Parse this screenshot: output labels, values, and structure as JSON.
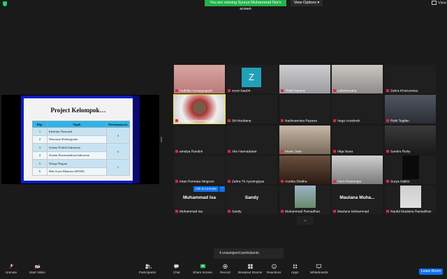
{
  "top": {
    "share_banner": "You are viewing Syurya Muhammad Nur's screen",
    "view_options": "View Options ▾",
    "view": "View"
  },
  "slide": {
    "title": "Project Kelompok…",
    "headers": [
      "Klp.",
      "Topik",
      "Pertemuan ke"
    ],
    "rows": [
      {
        "no": "1",
        "topic": "Identitas Nasional"
      },
      {
        "no": "2",
        "topic": "Wawasan Kebangsaan"
      },
      {
        "no": "3",
        "topic": "Sistem Politik Indonesia"
      },
      {
        "no": "4",
        "topic": "Sistem Pemerintahan Indonesia"
      },
      {
        "no": "5",
        "topic": "Warga Negara"
      },
      {
        "no": "6",
        "topic": "Hak Asasi Manusia (HAM)"
      }
    ],
    "meetings": [
      "3",
      "5",
      "7"
    ]
  },
  "gallery": {
    "tiles": [
      {
        "name": "Fadhilla Versayyaputri"
      },
      {
        "name": "zoom baa04",
        "initial": "Z"
      },
      {
        "name": "Thifal Namira"
      },
      {
        "name": "zalfahamaha"
      },
      {
        "name": "Zahra Khoirunnisa"
      },
      {
        "name": "Syurya Muhammad Nur"
      },
      {
        "name": "Siti Nurdiana"
      },
      {
        "name": "Nadimannisa Rayana"
      },
      {
        "name": "Vega Azzahrah"
      },
      {
        "name": "Rizki Tegilan"
      },
      {
        "name": "amelya Randini"
      },
      {
        "name": "Alia Hannadatari"
      },
      {
        "name": "Imam Joan"
      },
      {
        "name": "rifqa lizara"
      },
      {
        "name": "Sandro Rizky"
      },
      {
        "name": "Intan Permata Ningrum"
      },
      {
        "name": "Zahra Tri Ayuningtyas"
      },
      {
        "name": "Aurelia Shafira"
      },
      {
        "name": "Hani Khairuniya"
      },
      {
        "name": "Surya Hakim"
      },
      {
        "name": "Muhammad Isa",
        "big": "Muhammad Isa"
      },
      {
        "name": "Sandy",
        "big": "Sandy"
      },
      {
        "name": "Muhammad Ramadhan"
      },
      {
        "name": "Maulana Muhammad",
        "big": "Maulana Muha..."
      },
      {
        "name": "Naufal Maulana Ramadhan"
      }
    ],
    "ask_unmute": "Ask to Unmute",
    "ask_more": "···"
  },
  "toast": "4 unassigned participants",
  "toolbar": {
    "unmute": "Unmute",
    "start_video": "Start Video",
    "participants": "Participants",
    "participants_count": "51",
    "chat": "Chat",
    "share_screen": "Share Screen",
    "record": "Record",
    "breakout_rooms": "Breakout Rooms",
    "reactions": "Reactions",
    "apps": "Apps",
    "whiteboards": "Whiteboards",
    "leave": "Leave Room"
  },
  "colors": {
    "accent_blue": "#0e72ed",
    "share_green": "#24b24b",
    "slide_blue": "#0c1cc4",
    "table_header": "#2fb3e8"
  }
}
